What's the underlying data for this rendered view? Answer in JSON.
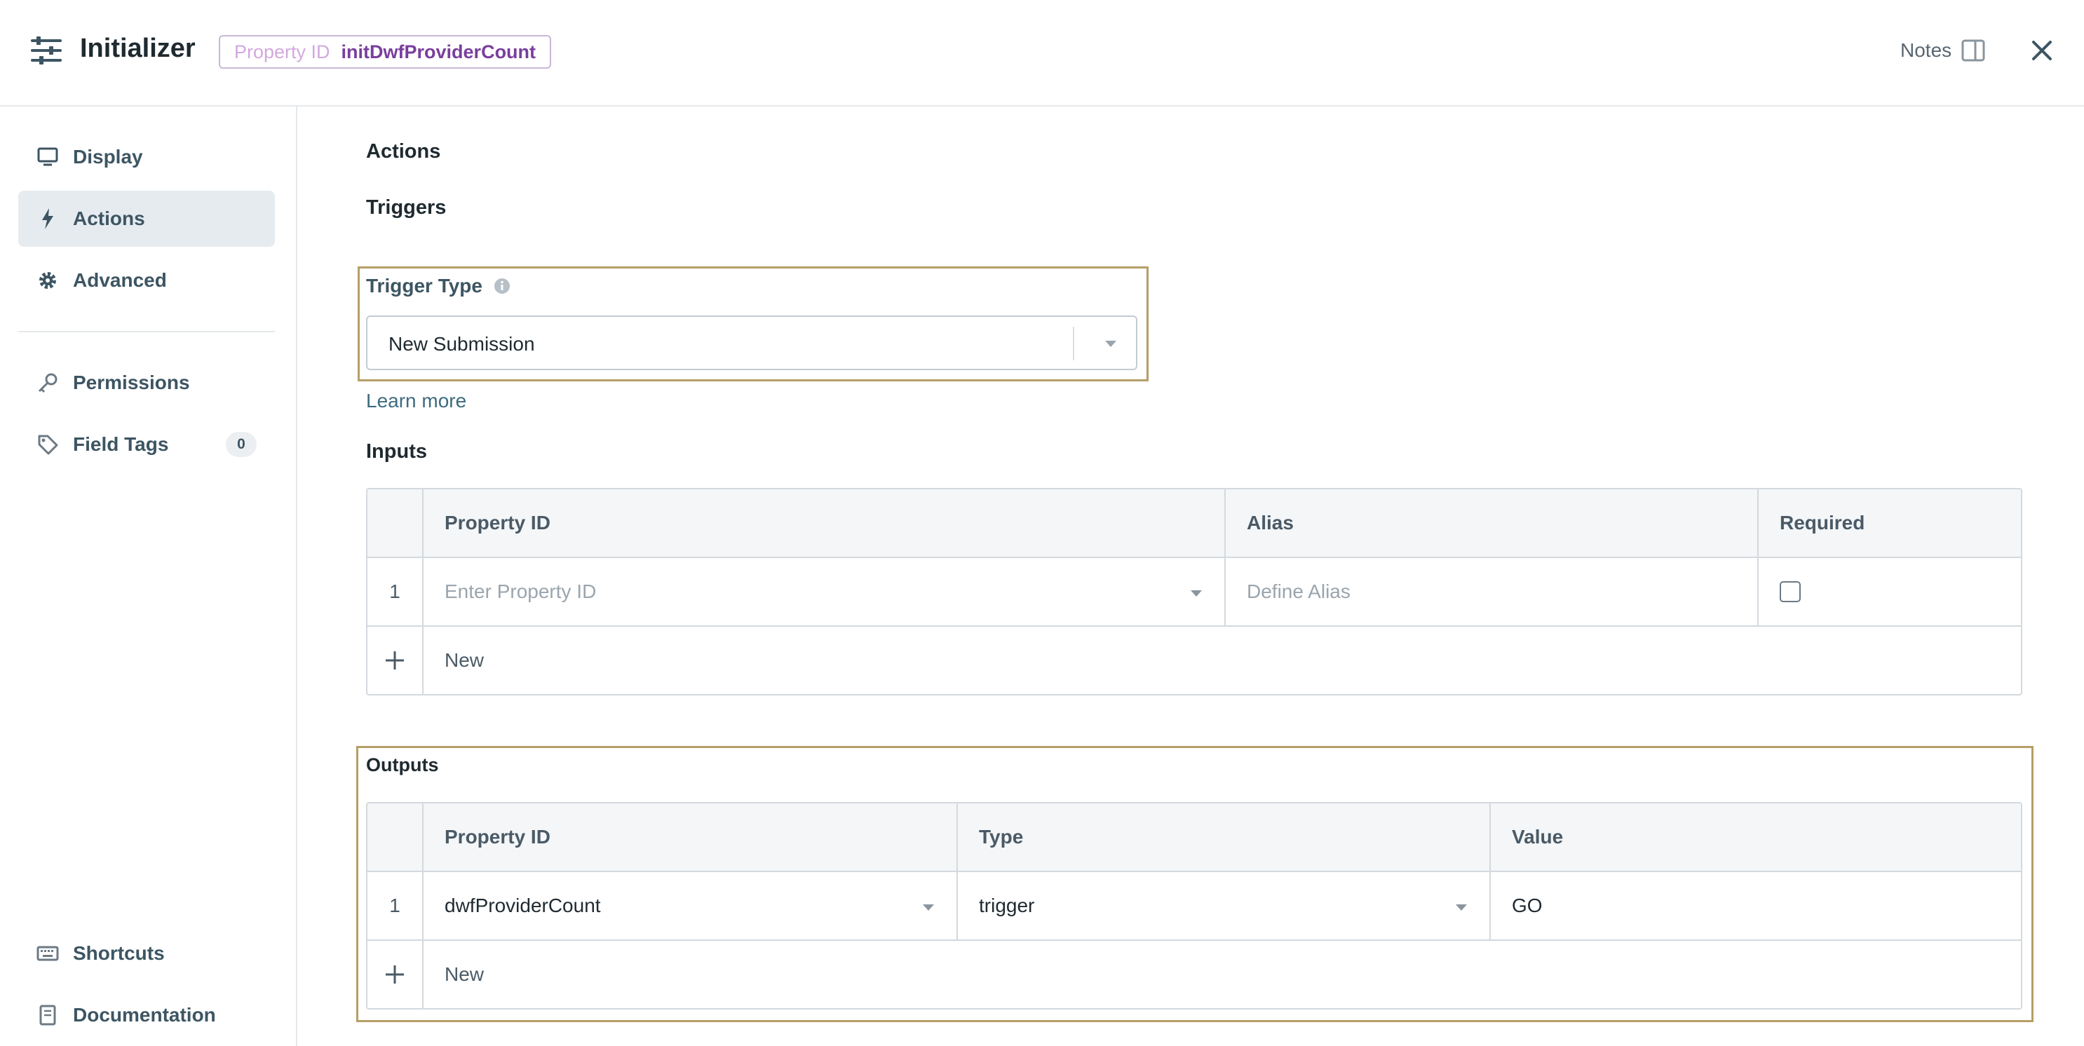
{
  "header": {
    "title": "Initializer",
    "property_id_label": "Property ID",
    "property_id_value": "initDwfProviderCount",
    "notes_label": "Notes"
  },
  "sidebar": {
    "items": [
      {
        "label": "Display",
        "icon": "monitor-icon"
      },
      {
        "label": "Actions",
        "icon": "lightning-icon",
        "active": true
      },
      {
        "label": "Advanced",
        "icon": "gear-icon"
      },
      {
        "label": "Permissions",
        "icon": "key-icon"
      },
      {
        "label": "Field Tags",
        "icon": "tag-icon",
        "count": "0"
      },
      {
        "label": "Shortcuts",
        "icon": "keyboard-icon"
      },
      {
        "label": "Documentation",
        "icon": "book-icon"
      }
    ]
  },
  "main": {
    "actions_title": "Actions",
    "triggers_title": "Triggers",
    "trigger_type_label": "Trigger Type",
    "trigger_type_value": "New Submission",
    "learn_more": "Learn more",
    "inputs": {
      "title": "Inputs",
      "columns": [
        "Property ID",
        "Alias",
        "Required"
      ],
      "rows": [
        {
          "index": "1",
          "property_id_placeholder": "Enter Property ID",
          "alias_placeholder": "Define Alias",
          "required": false
        }
      ],
      "new_label": "New"
    },
    "outputs": {
      "title": "Outputs",
      "columns": [
        "Property ID",
        "Type",
        "Value"
      ],
      "rows": [
        {
          "index": "1",
          "property_id": "dwfProviderCount",
          "type": "trigger",
          "value": "GO"
        }
      ],
      "new_label": "New"
    }
  },
  "colors": {
    "highlight": "#b59f66",
    "accent_purple": "#7a3e9d",
    "nav_active_bg": "#e6ebef"
  }
}
